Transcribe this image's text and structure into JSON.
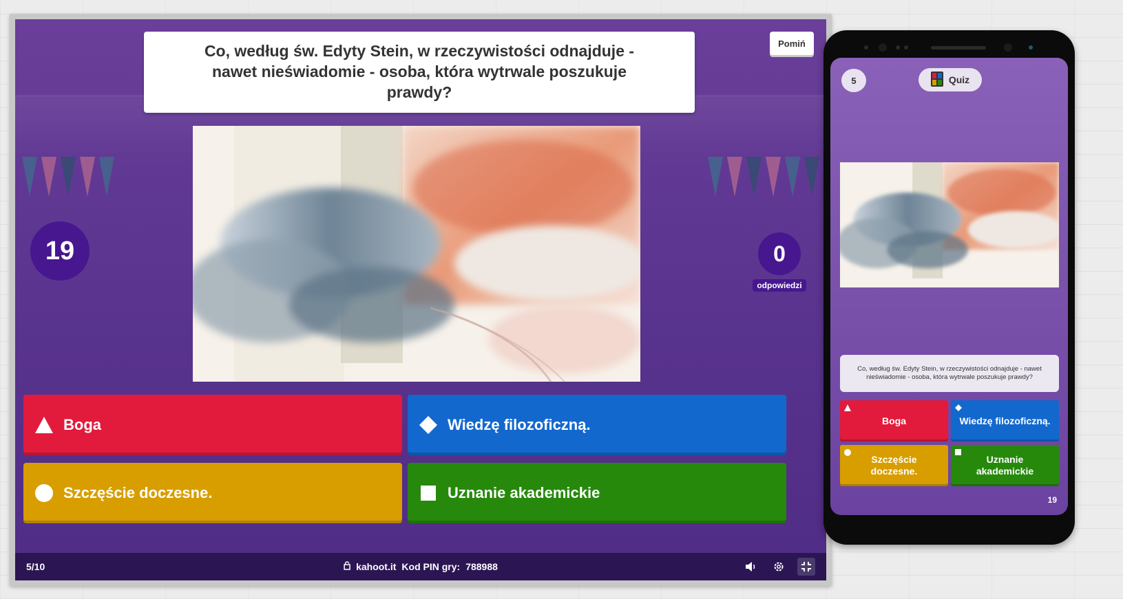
{
  "host": {
    "question": "Co, według św. Edyty Stein, w rzeczywistości odnajduje - nawet nieświadomie - osoba, która wytrwale poszukuje prawdy?",
    "skip_label": "Pomiń",
    "timer": "19",
    "answers_count": "0",
    "answers_label": "odpowiedzi",
    "answers": [
      {
        "text": "Boga",
        "color": "#e21b3c",
        "shape": "triangle-icon"
      },
      {
        "text": "Wiedzę filozoficzną.",
        "color": "#1368ce",
        "shape": "diamond-icon"
      },
      {
        "text": "Szczęście doczesne.",
        "color": "#d89e00",
        "shape": "circle-icon"
      },
      {
        "text": "Uznanie akademickie",
        "color": "#26890c",
        "shape": "square-icon"
      }
    ],
    "footer": {
      "progress": "5/10",
      "site": "kahoot.it",
      "pin_label": "Kod PIN gry:",
      "pin": "788988",
      "icons": [
        "lock-icon",
        "volume-icon",
        "settings-icon",
        "fullscreen-exit-icon"
      ]
    }
  },
  "phone": {
    "player_count": "5",
    "mode_label": "Quiz",
    "question": "Co, według św. Edyty Stein, w rzeczywistości odnajduje - nawet nieświadomie - osoba, która wytrwale poszukuje prawdy?",
    "answers": [
      {
        "text": "Boga",
        "shape": "triangle-icon"
      },
      {
        "text": "Wiedzę filozoficzną.",
        "shape": "diamond-icon"
      },
      {
        "text": "Szczęście doczesne.",
        "shape": "circle-icon"
      },
      {
        "text": "Uznanie akademickie",
        "shape": "square-icon"
      }
    ],
    "timer": "19"
  }
}
